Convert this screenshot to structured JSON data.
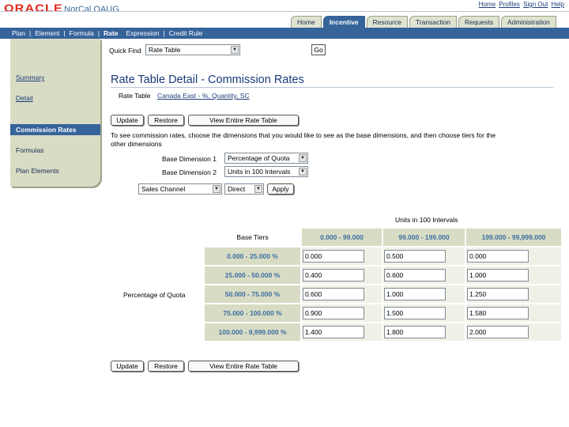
{
  "header": {
    "logo_text": "ORACLE",
    "app_name": "NorCal OAUG",
    "global_links": [
      "Home",
      "Profiles",
      "Sign Out",
      "Help"
    ],
    "tabs": [
      {
        "label": "Home",
        "active": false
      },
      {
        "label": "Incentive",
        "active": true
      },
      {
        "label": "Resource",
        "active": false
      },
      {
        "label": "Transaction",
        "active": false
      },
      {
        "label": "Requests",
        "active": false
      },
      {
        "label": "Administration",
        "active": false
      }
    ],
    "subnav": [
      {
        "label": "Plan",
        "active": false
      },
      {
        "label": "Element",
        "active": false
      },
      {
        "label": "Formula",
        "active": false
      },
      {
        "label": "Rate",
        "active": true
      },
      {
        "label": "Expression",
        "active": false
      },
      {
        "label": "Credit Rule",
        "active": false
      }
    ]
  },
  "quick_find": {
    "label": "Quick Find",
    "selected": "Rate Table",
    "go_label": "Go"
  },
  "sidebar": {
    "items": [
      {
        "label": "Summary",
        "active": false
      },
      {
        "label": "Detail",
        "active": false
      },
      {
        "label": "Commission Rates",
        "active": true
      },
      {
        "label": "Formulas",
        "active": false
      },
      {
        "label": "Plan Elements",
        "active": false
      }
    ]
  },
  "main": {
    "title": "Rate Table Detail - Commission Rates",
    "rate_table_label": "Rate Table",
    "rate_table_value": "Canada East - %, Quantity, SC",
    "buttons": {
      "update": "Update",
      "restore": "Restore",
      "view_entire": "View Entire Rate Table"
    },
    "instructions_line1": "To see commission rates, choose the dimensions that you would like to see as the base dimensions, and then choose tiers for the",
    "instructions_line2": "other dimensions",
    "base_dim1_label": "Base Dimension 1",
    "base_dim1_value": "Percentage of Quota",
    "base_dim2_label": "Base Dimension 2",
    "base_dim2_value": "Units in 100 Intervals",
    "other_dim_value": "Sales Channel",
    "other_tier_value": "Direct",
    "apply_label": "Apply"
  },
  "rate_table": {
    "column_dimension": "Units in 100 Intervals",
    "row_dimension": "Percentage of Quota",
    "corner_label": "Base Tiers",
    "columns": [
      "0.000 - 99.000",
      "99.000 - 199.000",
      "199.000 - 99,999.000"
    ],
    "rows": [
      {
        "tier": "0.000 - 25.000 %",
        "values": [
          "0.000",
          "0.500",
          "0.000"
        ]
      },
      {
        "tier": "25.000 - 50.000 %",
        "values": [
          "0.400",
          "0.600",
          "1.000"
        ]
      },
      {
        "tier": "50.000 - 75.000 %",
        "values": [
          "0.600",
          "1.000",
          "1.250"
        ]
      },
      {
        "tier": "75.000 - 100.000 %",
        "values": [
          "0.900",
          "1.500",
          "1.580"
        ]
      },
      {
        "tier": "100.000 - 9,999.000 %",
        "values": [
          "1.400",
          "1.800",
          "2.000"
        ]
      }
    ]
  }
}
